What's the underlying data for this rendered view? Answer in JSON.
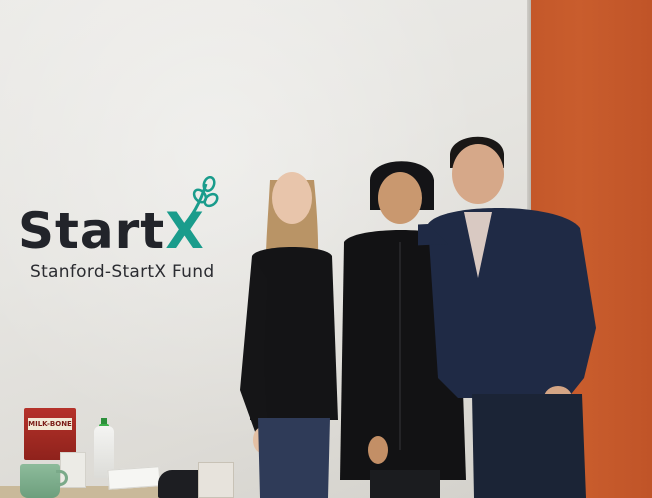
{
  "logo": {
    "word_main": "Start",
    "word_accent": "X",
    "subtitle": "Stanford-StartX Fund",
    "colors": {
      "text": "#22242a",
      "accent": "#1a9c8c",
      "sprout": "#1a9c8c"
    }
  },
  "props": {
    "milk_bone_label": "MILK-BONE"
  },
  "scene_colors": {
    "wall": "#e6e5e1",
    "orange_wall": "#c4582a"
  }
}
